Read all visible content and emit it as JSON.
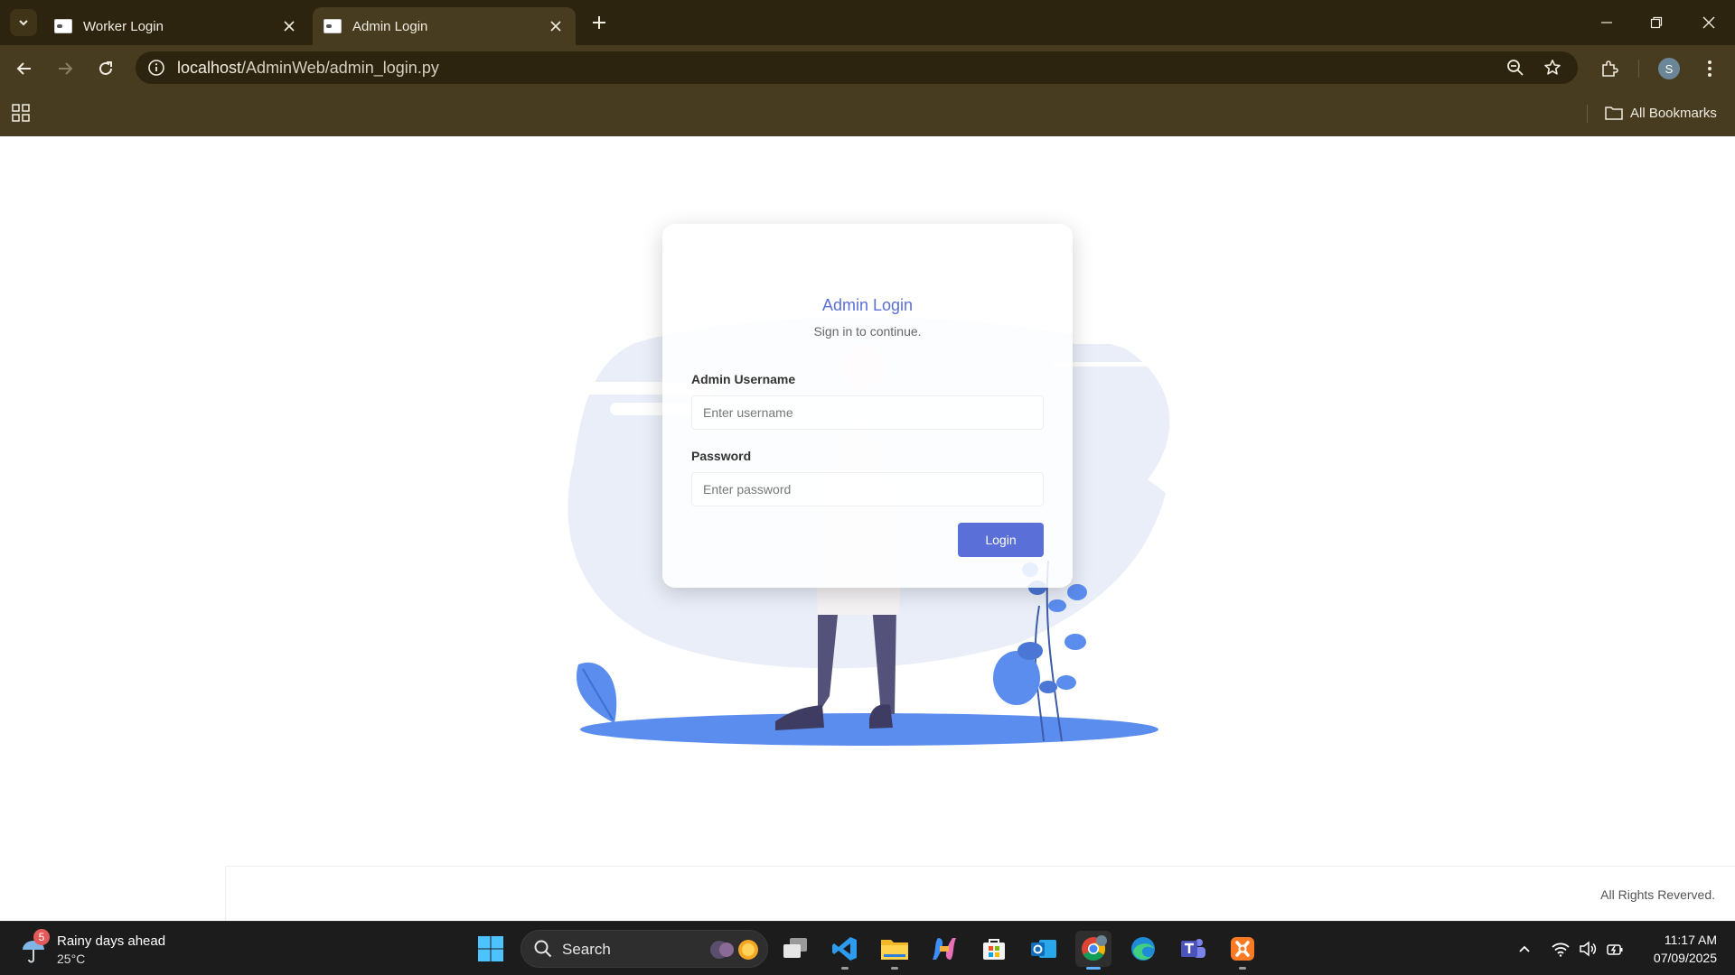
{
  "browser": {
    "tabs": [
      {
        "title": "Worker Login",
        "active": false
      },
      {
        "title": "Admin Login",
        "active": true
      }
    ],
    "url_host": "localhost",
    "url_path": "/AdminWeb/admin_login.py",
    "profile_initial": "S",
    "bookmarks_all_label": "All Bookmarks"
  },
  "login": {
    "title": "Admin Login",
    "subtitle": "Sign in to continue.",
    "username_label": "Admin Username",
    "username_placeholder": "Enter username",
    "username_value": "",
    "password_label": "Password",
    "password_placeholder": "Enter password",
    "password_value": "",
    "submit_label": "Login"
  },
  "footer": {
    "text": "All Rights Reverved."
  },
  "taskbar": {
    "weather_title": "Rainy days ahead",
    "weather_temp": "25°C",
    "weather_badge": "5",
    "search_label": "Search",
    "time": "11:17 AM",
    "date": "07/09/2025",
    "apps": [
      "task-view",
      "vscode",
      "file-explorer",
      "copilot",
      "microsoft-store",
      "outlook",
      "chrome",
      "edge",
      "teams",
      "xampp"
    ]
  },
  "colors": {
    "accent": "#5a6fd8",
    "chrome_dark": "#2d2410",
    "chrome_mid": "#473b20",
    "illustration_blue": "#5b8def",
    "illustration_bg": "#e9eef8"
  }
}
